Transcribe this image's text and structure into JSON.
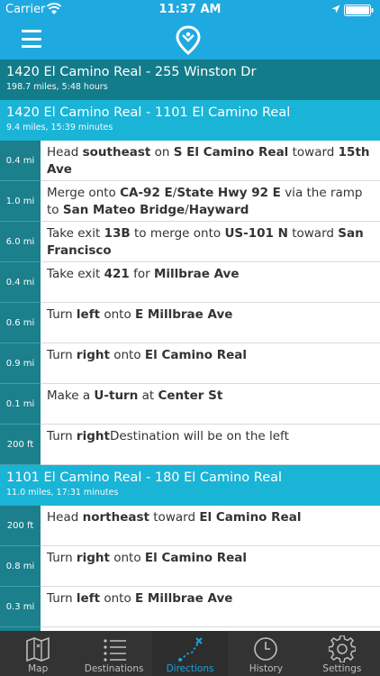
{
  "status_bar": {
    "carrier": "Carrier",
    "time": "11:37 AM"
  },
  "colors": {
    "accent": "#1ea9e0",
    "total_header": "#137c8a",
    "leg_header": "#1ab4d7",
    "distance_cell": "#1b7f8c",
    "tab_bar": "#333333",
    "tab_active": "#1aa3d9"
  },
  "icons": {
    "menu": "hamburger-icon",
    "logo": "map-pin-logo-icon",
    "wifi": "wifi-icon",
    "location": "location-arrow-icon",
    "battery": "battery-icon"
  },
  "route": {
    "total": {
      "title": "1420 El Camino Real - 255 Winston Dr",
      "summary": "198.7 miles, 5:48 hours"
    },
    "legs": [
      {
        "title": "1420 El Camino Real - 1101 El Camino Real",
        "summary": "9.4 miles, 15:39 minutes",
        "steps": [
          {
            "distance": "0.4 mi",
            "parts": [
              {
                "t": "Head "
              },
              {
                "t": "southeast",
                "b": true
              },
              {
                "t": " on "
              },
              {
                "t": "S El Camino Real",
                "b": true
              },
              {
                "t": " toward "
              },
              {
                "t": "15th Ave",
                "b": true
              }
            ]
          },
          {
            "distance": "1.0 mi",
            "parts": [
              {
                "t": "Merge onto "
              },
              {
                "t": "CA-92 E",
                "b": true
              },
              {
                "t": "/"
              },
              {
                "t": "State Hwy 92 E",
                "b": true
              },
              {
                "t": " via the ramp to "
              },
              {
                "t": "San Mateo Bridge",
                "b": true
              },
              {
                "t": "/"
              },
              {
                "t": "Hayward",
                "b": true
              }
            ]
          },
          {
            "distance": "6.0 mi",
            "parts": [
              {
                "t": "Take exit "
              },
              {
                "t": "13B",
                "b": true
              },
              {
                "t": " to merge onto "
              },
              {
                "t": "US-101 N",
                "b": true
              },
              {
                "t": " toward "
              },
              {
                "t": "San Francisco",
                "b": true
              }
            ]
          },
          {
            "distance": "0.4 mi",
            "parts": [
              {
                "t": "Take exit "
              },
              {
                "t": "421",
                "b": true
              },
              {
                "t": " for "
              },
              {
                "t": "Millbrae Ave",
                "b": true
              }
            ]
          },
          {
            "distance": "0.6 mi",
            "parts": [
              {
                "t": "Turn "
              },
              {
                "t": "left",
                "b": true
              },
              {
                "t": " onto "
              },
              {
                "t": "E Millbrae Ave",
                "b": true
              }
            ]
          },
          {
            "distance": "0.9 mi",
            "parts": [
              {
                "t": "Turn "
              },
              {
                "t": "right",
                "b": true
              },
              {
                "t": " onto "
              },
              {
                "t": "El Camino Real",
                "b": true
              }
            ]
          },
          {
            "distance": "0.1 mi",
            "parts": [
              {
                "t": "Make a "
              },
              {
                "t": "U-turn",
                "b": true
              },
              {
                "t": " at "
              },
              {
                "t": "Center St",
                "b": true
              }
            ]
          },
          {
            "distance": "200 ft",
            "parts": [
              {
                "t": "Turn "
              },
              {
                "t": "right",
                "b": true
              },
              {
                "t": "Destination will be on the left"
              }
            ]
          }
        ]
      },
      {
        "title": "1101 El Camino Real - 180 El Camino Real",
        "summary": "11.0 miles, 17:31 minutes",
        "steps": [
          {
            "distance": "200 ft",
            "parts": [
              {
                "t": "Head "
              },
              {
                "t": "northeast",
                "b": true
              },
              {
                "t": " toward "
              },
              {
                "t": "El Camino Real",
                "b": true
              }
            ]
          },
          {
            "distance": "0.8 mi",
            "parts": [
              {
                "t": "Turn "
              },
              {
                "t": "right",
                "b": true
              },
              {
                "t": " onto "
              },
              {
                "t": "El Camino Real",
                "b": true
              }
            ]
          },
          {
            "distance": "0.3 mi",
            "parts": [
              {
                "t": "Turn "
              },
              {
                "t": "left",
                "b": true
              },
              {
                "t": " onto "
              },
              {
                "t": "E Millbrae Ave",
                "b": true
              }
            ]
          },
          {
            "distance": "",
            "parts": []
          }
        ]
      }
    ]
  },
  "tabs": [
    {
      "label": "Map",
      "icon": "map-icon",
      "active": false
    },
    {
      "label": "Destinations",
      "icon": "list-icon",
      "active": false
    },
    {
      "label": "Directions",
      "icon": "route-icon",
      "active": true
    },
    {
      "label": "History",
      "icon": "clock-icon",
      "active": false
    },
    {
      "label": "Settings",
      "icon": "gear-icon",
      "active": false
    }
  ]
}
